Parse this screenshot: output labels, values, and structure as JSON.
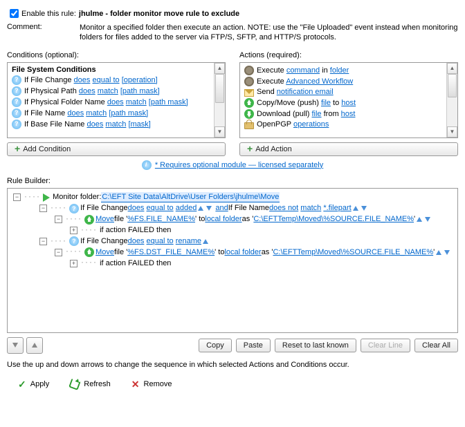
{
  "header": {
    "enable_label": "Enable this rule:",
    "title": "jhulme - folder monitor move rule to exclude",
    "comment_label": "Comment:",
    "comment_text": "Monitor a specified folder then execute an action. NOTE: use the \"File Uploaded\" event instead when monitoring folders for files added to the server via FTP/S, SFTP, and HTTP/S protocols."
  },
  "conditions": {
    "label": "Conditions (optional):",
    "group_header": "File System Conditions",
    "items": [
      {
        "prefix": "If File Change ",
        "l1": "does",
        "l2": "equal to",
        "l3": "[operation]"
      },
      {
        "prefix": "If Physical Path ",
        "l1": "does",
        "l2": "match",
        "l3": "[path mask]"
      },
      {
        "prefix": "If Physical Folder Name ",
        "l1": "does",
        "l2": "match",
        "l3": "[path mask]"
      },
      {
        "prefix": "If File Name ",
        "l1": "does",
        "l2": "match",
        "l3": "[path mask]"
      },
      {
        "prefix": "If Base File Name ",
        "l1": "does",
        "l2": "match",
        "l3": "[mask]"
      }
    ],
    "add_button": "Add Condition"
  },
  "actions": {
    "label": "Actions (required):",
    "items": [
      {
        "icon": "gear",
        "prefix": "Execute ",
        "l1": "command",
        "mid": " in ",
        "l2": "folder"
      },
      {
        "icon": "gear",
        "prefix": "Execute ",
        "l1": "Advanced Workflow"
      },
      {
        "icon": "mail",
        "prefix": "Send ",
        "l1": "notification email"
      },
      {
        "icon": "up",
        "prefix": "Copy/Move (push) ",
        "l1": "file",
        "mid": " to ",
        "l2": "host"
      },
      {
        "icon": "down",
        "prefix": "Download (pull) ",
        "l1": "file",
        "mid": " from ",
        "l2": "host"
      },
      {
        "icon": "lock",
        "prefix": "OpenPGP ",
        "l1": "operations"
      }
    ],
    "add_button": "Add Action"
  },
  "licensed_link": "* Requires optional module — licensed separately",
  "rule_builder": {
    "label": "Rule Builder:",
    "monitor_prefix": "Monitor folder: ",
    "monitor_path": "C:\\EFT Site Data\\AltDrive\\User Folders\\jhulme\\Move",
    "cond1_a_prefix": "If File Change ",
    "cond1_a_l1": "does",
    "cond1_a_l2": "equal to",
    "cond1_a_l3": "added",
    "and": "and",
    "cond1_b_prefix": " If File Name ",
    "cond1_b_l1": "does not",
    "cond1_b_l2": "match",
    "cond1_b_l3": "*.filepart",
    "move_l": "Move",
    "move1_file": " file '",
    "move1_src": "%FS.FILE_NAME%",
    "to": "' to ",
    "local_folder": "local folder",
    "as": " as '",
    "move1_dest": "C:\\EFTTemp\\Moved\\%SOURCE.FILE_NAME%",
    "suffix_q": "' ",
    "failed": "if action FAILED then",
    "cond2_prefix": "If File Change ",
    "cond2_l1": "does",
    "cond2_l2": "equal to",
    "cond2_l3": "rename",
    "move2_src": "%FS.DST_FILE_NAME%",
    "move2_dest": "C:\\EFTTemp\\Moved\\%SOURCE.FILE_NAME%"
  },
  "bottom": {
    "copy": "Copy",
    "paste": "Paste",
    "reset": "Reset to last known",
    "clear_line": "Clear Line",
    "clear_all": "Clear All",
    "help": "Use the up and down arrows to change the sequence in which selected Actions and Conditions occur.",
    "apply": "Apply",
    "refresh": "Refresh",
    "remove": "Remove"
  }
}
